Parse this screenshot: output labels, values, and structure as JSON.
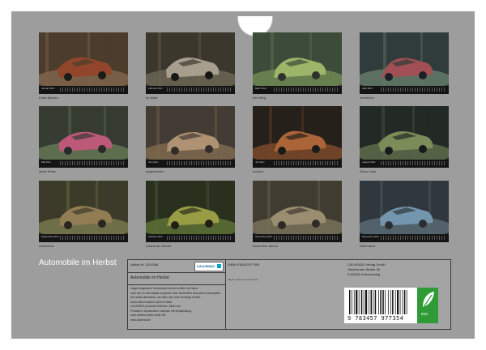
{
  "calendar": {
    "title": "Automobile im Herbst",
    "months": [
      {
        "label": "Januar 20xx",
        "caption": "Ende Backen",
        "palette": [
          "#4e3a2c",
          "#6f5846",
          "#8a6a52",
          "#a0462b",
          "#3d4a2e"
        ]
      },
      {
        "label": "Februar 20xx",
        "caption": "im Wald",
        "palette": [
          "#3f3a2f",
          "#5c5545",
          "#76715c",
          "#bcb3a2",
          "#2f2a21"
        ]
      },
      {
        "label": "März 20xx",
        "caption": "den Weg",
        "palette": [
          "#243322",
          "#3a4f30",
          "#5e7a3e",
          "#93b057",
          "#cdd7c6"
        ]
      },
      {
        "label": "April 20xx",
        "caption": "vertrieben",
        "palette": [
          "#2e342d",
          "#4f5a48",
          "#6a7d63",
          "#b34a4a",
          "#3b6e8a"
        ]
      },
      {
        "label": "Mai 20xx",
        "caption": "letzte Reise",
        "palette": [
          "#262a23",
          "#3e4a35",
          "#5b6e4a",
          "#c24a75",
          "#9aa58a"
        ]
      },
      {
        "label": "Juni 20xx",
        "caption": "abgestorben",
        "palette": [
          "#2a2520",
          "#4e3f30",
          "#70593f",
          "#a98a6a",
          "#d6c3a8"
        ]
      },
      {
        "label": "Juli 20xx",
        "caption": "morsch",
        "palette": [
          "#231c17",
          "#4e2f20",
          "#8a4a2a",
          "#c06a3a",
          "#35402c"
        ]
      },
      {
        "label": "August 20xx",
        "caption": "Glanz funkt",
        "palette": [
          "#22261f",
          "#3c4733",
          "#66744c",
          "#8a9a5c",
          "#2c3d4a"
        ]
      },
      {
        "label": "September 20xx",
        "caption": "schleichen",
        "palette": [
          "#2a2d22",
          "#4a5036",
          "#6e744c",
          "#8f7a52",
          "#a88a60"
        ]
      },
      {
        "label": "Oktober 20xx",
        "caption": "Urlaub am Rande",
        "palette": [
          "#1f2a1c",
          "#34472c",
          "#5b7436",
          "#a0a848",
          "#6a5a2e"
        ]
      },
      {
        "label": "November 20xx",
        "caption": "November Abend",
        "palette": [
          "#2a2822",
          "#474437",
          "#6b6650",
          "#94886a",
          "#c0b08a"
        ]
      },
      {
        "label": "Dezember 20xx",
        "caption": "Rabenacht",
        "palette": [
          "#1a2024",
          "#2e3a40",
          "#4a5a63",
          "#6a8ea8",
          "#b0c4d0"
        ]
      }
    ]
  },
  "info": {
    "article": "Artikel-Nr. 2510348",
    "subtitle": "Automobile im Herbst",
    "description_lines": [
      "Längst vergessene Schrottautos sind es inmitten der Natur,",
      "nach wie vor Schrottplatz vergessen einer letztendlich besonderer Atmosphäre",
      "sich selbst überlassen, die Natur eine neue Herberge erobert.",
      "Autos stehen weitere Jahre im Wald.",
      "CALVENDO produziert Kalender, Bilder und",
      "Produkte in Deutschland. Kalender mit Spiralbindung.",
      "Auch weitere Motive finden Sie",
      "www.calvendo.de"
    ],
    "isbn": "ISBN 9783457977354",
    "photographer": "Martin Lüdemann Fotomarkt",
    "publisher_lines": [
      "CALVENDO Verlag GmbH",
      "Ottobrunner Straße 39",
      "D-82008 Unterhaching"
    ],
    "logo_text": "CALVENDO",
    "barcode_number": "9 783457 977354",
    "eco_label": "eco"
  }
}
